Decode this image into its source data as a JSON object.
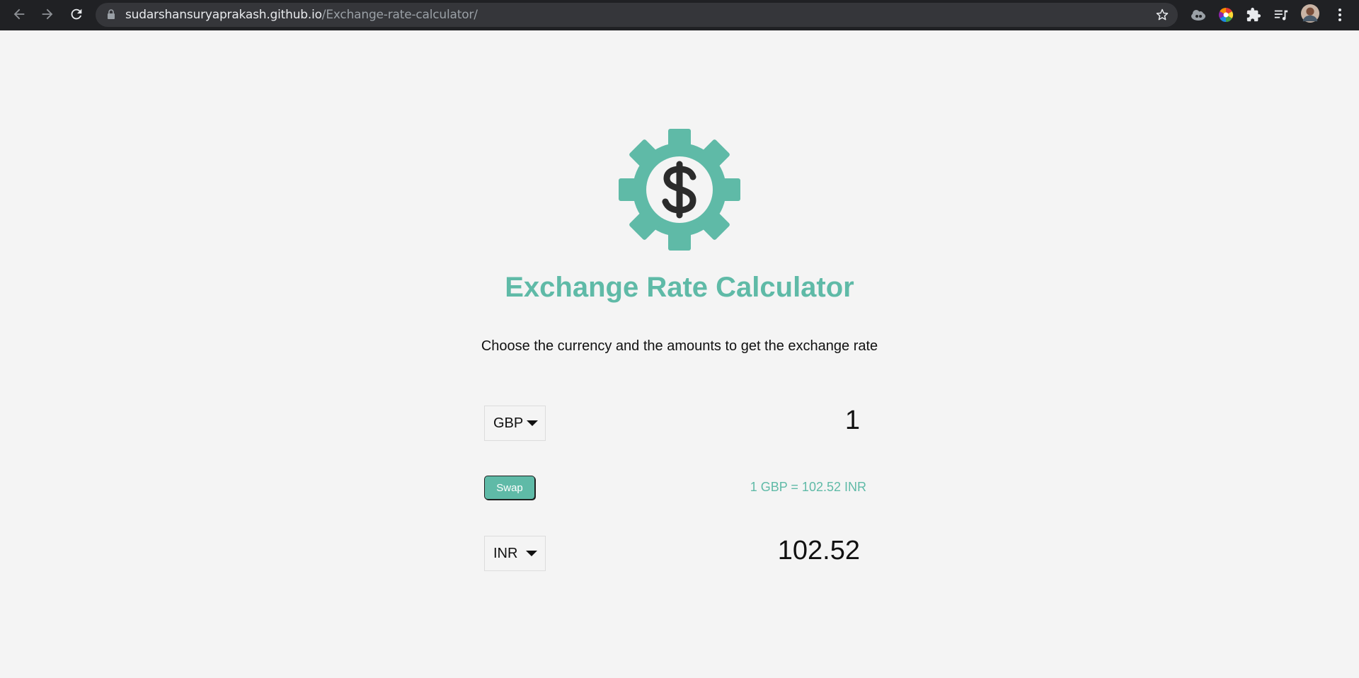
{
  "browser": {
    "url_host": "sudarshansuryaprakash.github.io",
    "url_path": "/Exchange-rate-calculator/",
    "icons": [
      "back-arrow-icon",
      "forward-arrow-icon",
      "reload-icon",
      "lock-icon",
      "star-icon",
      "cloud-extension-icon",
      "color-extension-icon",
      "puzzle-extensions-icon",
      "reading-list-icon",
      "profile-avatar",
      "kebab-menu-icon"
    ],
    "colors": {
      "toolbar": "#202124",
      "omnibox": "#35363a"
    }
  },
  "app": {
    "logo_icon": "dollar-gear-icon",
    "title": "Exchange Rate Calculator",
    "subtitle": "Choose the currency and the amounts to get the exchange rate",
    "currency_one": {
      "code": "GBP",
      "amount": "1"
    },
    "swap_label": "Swap",
    "rate_text": "1 GBP = 102.52 INR",
    "currency_two": {
      "code": "INR",
      "amount": "102.52"
    },
    "colors": {
      "accent": "#5fbaa7",
      "background": "#f4f4f4",
      "text": "#111111"
    }
  }
}
